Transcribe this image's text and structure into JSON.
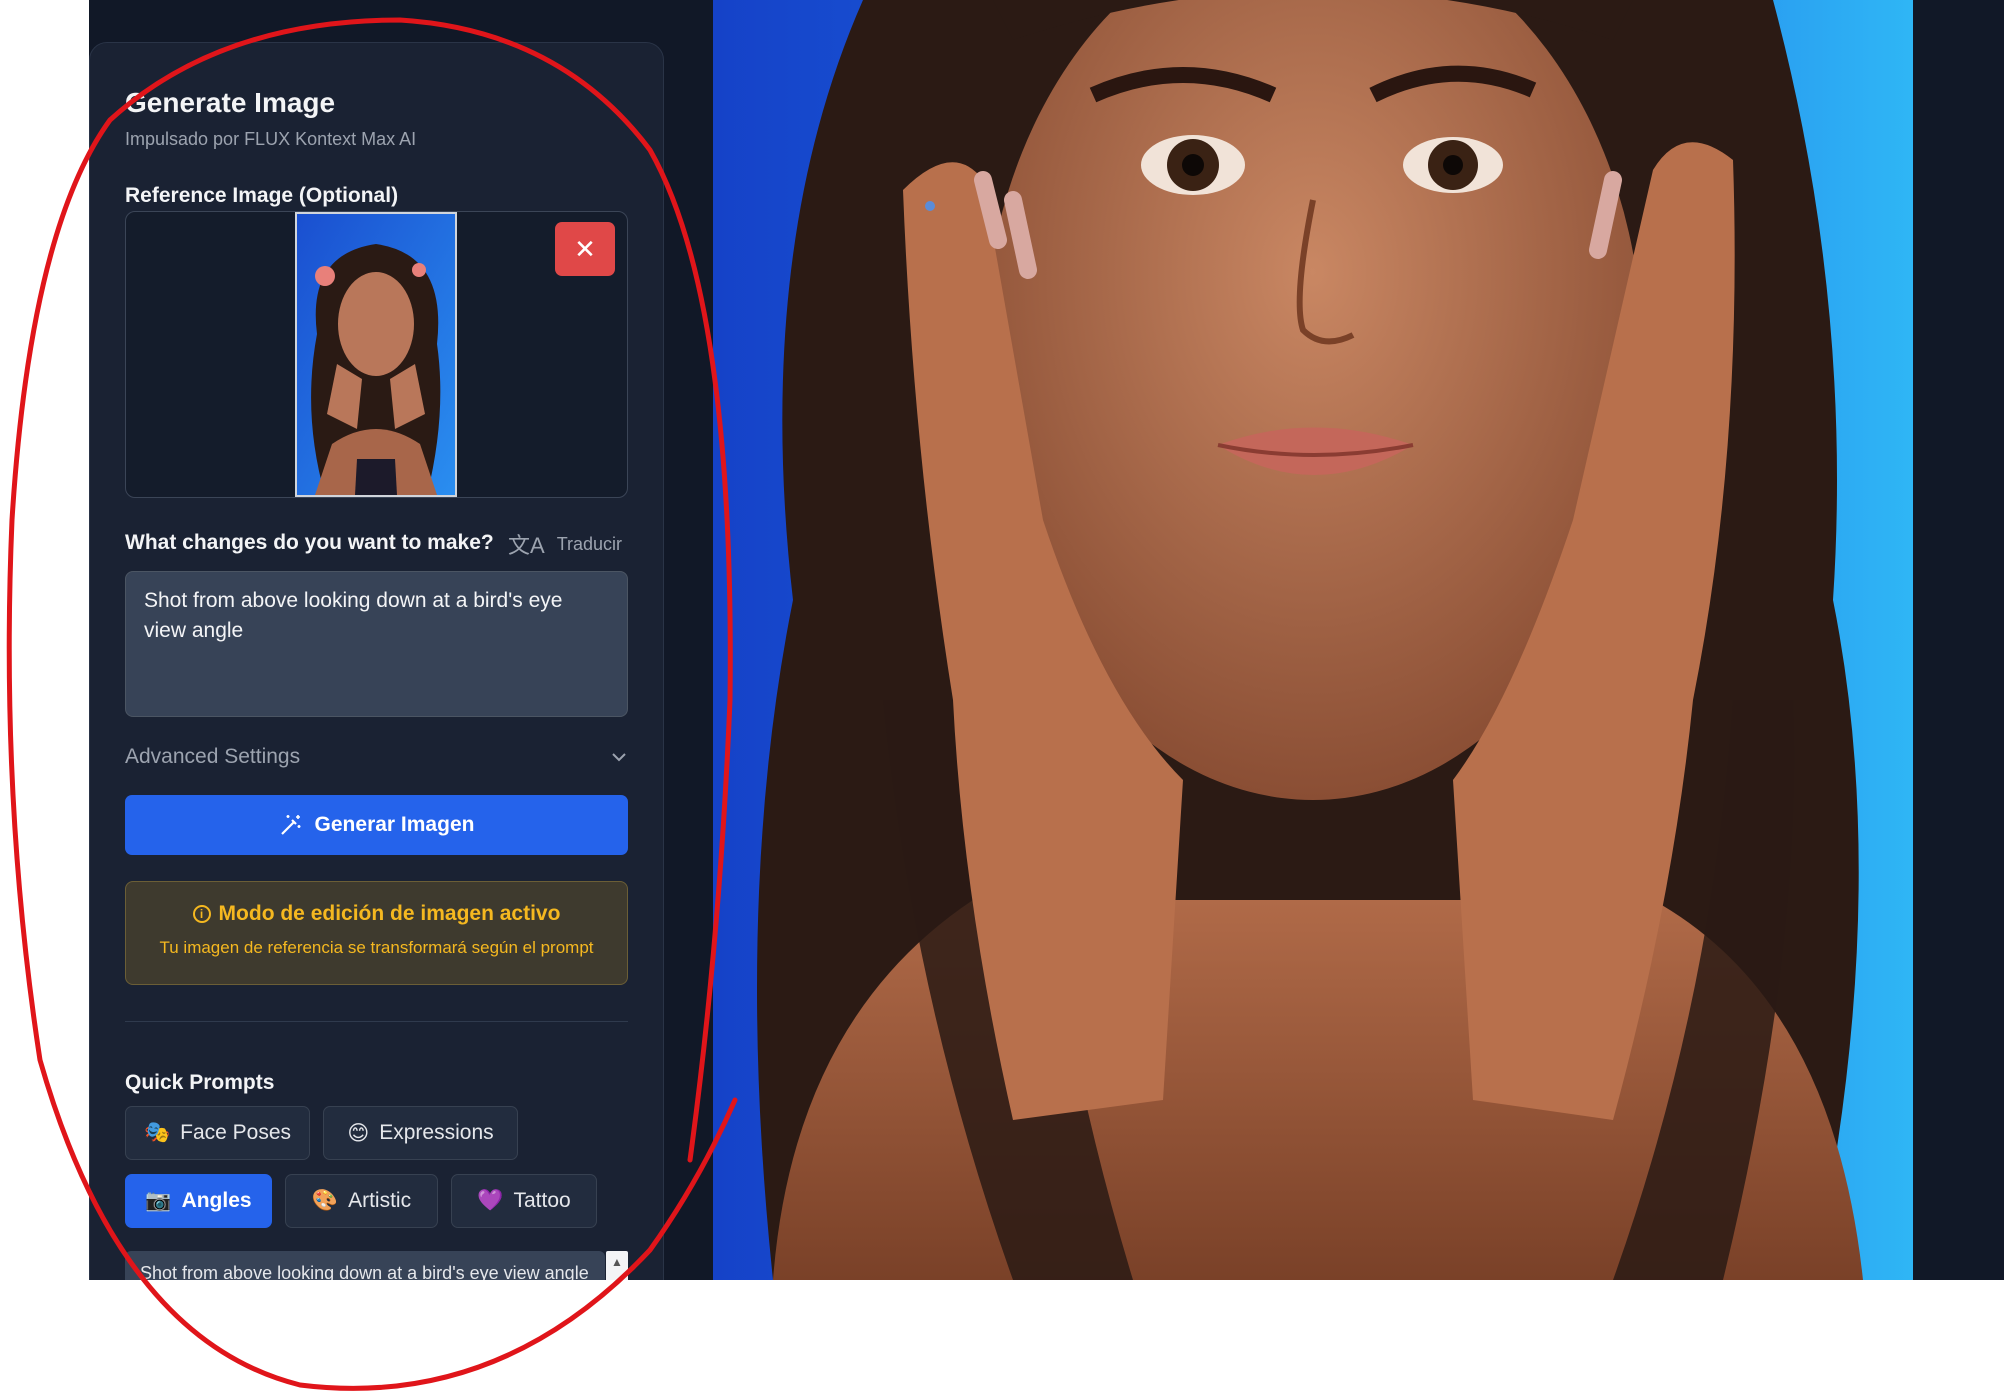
{
  "panel": {
    "title": "Generate Image",
    "subtitle": "Impulsado por FLUX Kontext Max AI"
  },
  "reference": {
    "label": "Reference Image (Optional)",
    "remove_icon": "✕"
  },
  "changes": {
    "label": "What changes do you want to make?",
    "translate_label": "Traducir",
    "translate_icon": "文A",
    "prompt_value": "Shot from above looking down at a bird's eye view angle"
  },
  "advanced": {
    "label": "Advanced Settings"
  },
  "generate": {
    "label": "Generar Imagen"
  },
  "notice": {
    "title": "Modo de edición de imagen activo",
    "text": "Tu imagen de referencia se transformará según el prompt"
  },
  "quick_prompts": {
    "label": "Quick Prompts",
    "chips": [
      {
        "emoji": "🎭",
        "label": "Face Poses"
      },
      {
        "emoji": "😊",
        "label": "Expressions"
      },
      {
        "emoji": "📷",
        "label": "Angles"
      },
      {
        "emoji": "🎨",
        "label": "Artistic"
      },
      {
        "emoji": "💜",
        "label": "Tattoo"
      }
    ],
    "active": "Angles",
    "snippet": "Shot from above looking down at a bird's eye view angle"
  },
  "colors": {
    "accent": "#2563eb",
    "danger": "#e04848",
    "warning": "#f5b820",
    "annotation": "#e0151a"
  }
}
